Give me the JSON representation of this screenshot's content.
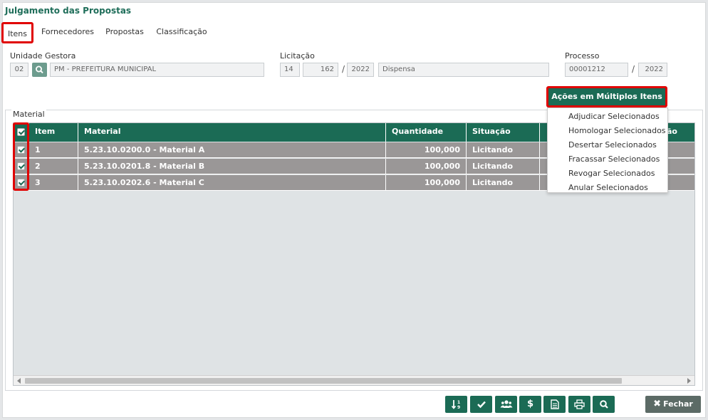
{
  "page_title": "Julgamento das Propostas",
  "tabs": [
    {
      "label": "Itens",
      "active": true
    },
    {
      "label": "Fornecedores"
    },
    {
      "label": "Propostas"
    },
    {
      "label": "Classificação"
    }
  ],
  "unidade_gestora": {
    "label": "Unidade Gestora",
    "code": "02",
    "name": "PM - PREFEITURA MUNICIPAL"
  },
  "licitacao": {
    "label": "Licitação",
    "tipo": "14",
    "numero": "162",
    "ano": "2022",
    "modalidade": "Dispensa"
  },
  "processo": {
    "label": "Processo",
    "numero": "00001212",
    "ano": "2022"
  },
  "acoes_button": {
    "label": "Ações em Múltiplos Itens"
  },
  "acoes_menu": [
    "Adjudicar Selecionados",
    "Homologar Selecionados",
    "Desertar Selecionados",
    "Fracassar Selecionados",
    "Revogar Selecionados",
    "Anular Selecionados"
  ],
  "material_section": {
    "legend": "Material"
  },
  "table": {
    "headers": {
      "item": "Item",
      "material": "Material",
      "quantidade": "Quantidade",
      "situacao": "Situação",
      "partial": "ão"
    },
    "rows": [
      {
        "item": "1",
        "material": "5.23.10.0200.0 - Material A",
        "quantidade": "100,000",
        "situacao": "Licitando"
      },
      {
        "item": "2",
        "material": "5.23.10.0201.8 - Material B",
        "quantidade": "100,000",
        "situacao": "Licitando"
      },
      {
        "item": "3",
        "material": "5.23.10.0202.6 - Material C",
        "quantidade": "100,000",
        "situacao": "Licitando"
      }
    ]
  },
  "footer": {
    "fechar_label": "Fechar"
  },
  "colors": {
    "primary": "#1b6b55",
    "highlight": "#e00000",
    "row_selected": "#9a9797"
  }
}
